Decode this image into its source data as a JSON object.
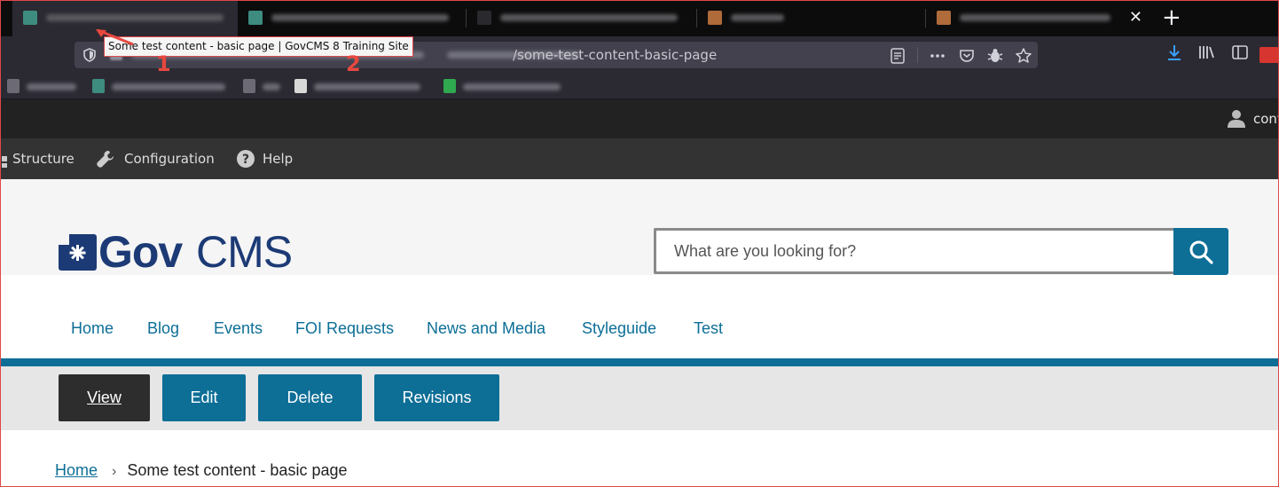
{
  "browser": {
    "tooltip": "Some test content - basic page | GovCMS 8 Training Site",
    "url_visible": "/some-test-content-basic-page",
    "annotations": [
      "1",
      "2"
    ],
    "close_glyph": "✕",
    "newtab_glyph": "+"
  },
  "admin": {
    "user_label": "cont",
    "menu": [
      {
        "label": "Structure",
        "icon": "structure-icon"
      },
      {
        "label": "Configuration",
        "icon": "wrench-icon"
      },
      {
        "label": "Help",
        "icon": "help-icon"
      }
    ]
  },
  "site": {
    "logo_bold": "Gov",
    "logo_light": "CMS",
    "search_placeholder": "What are you looking for?",
    "nav": [
      "Home",
      "Blog",
      "Events",
      "FOI Requests",
      "News and Media",
      "Styleguide",
      "Test"
    ]
  },
  "tasks": {
    "view": "View",
    "edit": "Edit",
    "delete": "Delete",
    "revisions": "Revisions"
  },
  "breadcrumb": {
    "home": "Home",
    "separator": "›",
    "current": "Some test content - basic page"
  },
  "colors": {
    "brand_navy": "#1c3a75",
    "link_blue": "#0d6e96",
    "annotation_red": "#e8483f"
  }
}
